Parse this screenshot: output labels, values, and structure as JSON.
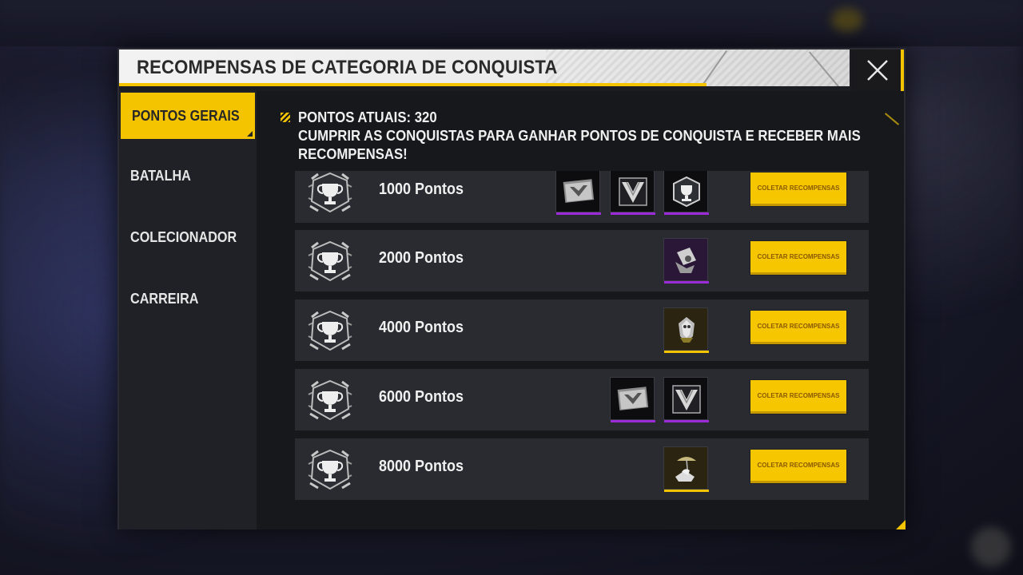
{
  "dialog": {
    "title": "RECOMPENSAS DE CATEGORIA DE CONQUISTA"
  },
  "sidebar": {
    "items": [
      {
        "label": "PONTOS GERAIS",
        "active": true
      },
      {
        "label": "BATALHA",
        "active": false
      },
      {
        "label": "COLECIONADOR",
        "active": false
      },
      {
        "label": "CARREIRA",
        "active": false
      }
    ]
  },
  "info": {
    "current_points": "PONTOS ATUAIS: 320",
    "description_line1": "CUMPRIR AS CONQUISTAS PARA GANHAR PONTOS DE CONQUISTA E RECEBER MAIS",
    "description_line2": "RECOMPENSAS!"
  },
  "tiers": [
    {
      "points": "1000 Pontos",
      "button": "COLETAR RECOMPENSAS",
      "rewards": [
        "banner-icon",
        "avatar-v-icon",
        "trophy-badge-icon"
      ]
    },
    {
      "points": "2000 Pontos",
      "button": "COLETAR RECOMPENSAS",
      "rewards": [
        "emote-icon"
      ]
    },
    {
      "points": "4000 Pontos",
      "button": "COLETAR RECOMPENSAS",
      "rewards": [
        "pet-skin-icon"
      ]
    },
    {
      "points": "6000 Pontos",
      "button": "COLETAR RECOMPENSAS",
      "rewards": [
        "banner-icon",
        "avatar-v-icon"
      ]
    },
    {
      "points": "8000 Pontos",
      "button": "COLETAR RECOMPENSAS",
      "rewards": [
        "beach-chair-icon"
      ]
    }
  ],
  "colors": {
    "accent": "#f4c400",
    "rarity_purple": "#9a2bd6",
    "rarity_gold": "#f4c400"
  }
}
